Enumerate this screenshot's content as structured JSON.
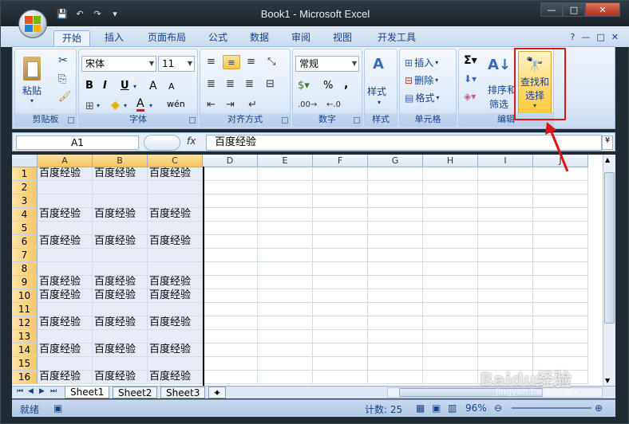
{
  "window": {
    "title": "Book1 - Microsoft Excel",
    "minimize": "—",
    "restore": "□",
    "close": "✕"
  },
  "qat": {
    "save": "💾",
    "undo": "↶",
    "redo": "↷",
    "custom": "▾"
  },
  "tabs": [
    "开始",
    "插入",
    "页面布局",
    "公式",
    "数据",
    "审阅",
    "视图",
    "开发工具"
  ],
  "tab_active": "开始",
  "ribbon": {
    "clipboard": {
      "label": "剪贴板",
      "paste": "粘贴"
    },
    "font": {
      "label": "字体",
      "name": "宋体",
      "size": "11",
      "bold": "B",
      "italic": "I",
      "underline": "U",
      "grow": "A",
      "shrink": "A",
      "wen": "wén"
    },
    "alignment": {
      "label": "对齐方式"
    },
    "number": {
      "label": "数字",
      "format": "常规",
      "percent": "%",
      "comma": ","
    },
    "styles": {
      "label": "样式",
      "button": "样式"
    },
    "cells": {
      "label": "单元格",
      "insert": "插入",
      "delete": "删除",
      "format": "格式"
    },
    "editing": {
      "label": "编辑",
      "sort": "排序和",
      "sort2": "筛选",
      "find": "查找和",
      "find2": "选择"
    }
  },
  "formula_bar": {
    "name_box": "A1",
    "fx": "fx",
    "value": "百度经验"
  },
  "columns": [
    "A",
    "B",
    "C",
    "D",
    "E",
    "F",
    "G",
    "H",
    "I",
    "J"
  ],
  "rows": [
    {
      "n": "1",
      "cells": [
        "百度经验",
        "百度经验",
        "百度经验"
      ]
    },
    {
      "n": "2",
      "cells": [
        "",
        "",
        ""
      ]
    },
    {
      "n": "3",
      "cells": [
        "",
        "",
        ""
      ]
    },
    {
      "n": "4",
      "cells": [
        "百度经验",
        "百度经验",
        "百度经验"
      ]
    },
    {
      "n": "5",
      "cells": [
        "",
        "",
        ""
      ]
    },
    {
      "n": "6",
      "cells": [
        "百度经验",
        "百度经验",
        "百度经验"
      ]
    },
    {
      "n": "7",
      "cells": [
        "",
        "",
        ""
      ]
    },
    {
      "n": "8",
      "cells": [
        "",
        "",
        ""
      ]
    },
    {
      "n": "9",
      "cells": [
        "百度经验",
        "百度经验",
        "百度经验"
      ]
    },
    {
      "n": "10",
      "cells": [
        "百度经验",
        "百度经验",
        "百度经验"
      ]
    },
    {
      "n": "11",
      "cells": [
        "",
        "",
        ""
      ]
    },
    {
      "n": "12",
      "cells": [
        "百度经验",
        "百度经验",
        "百度经验"
      ]
    },
    {
      "n": "13",
      "cells": [
        "",
        "",
        ""
      ]
    },
    {
      "n": "14",
      "cells": [
        "百度经验",
        "百度经验",
        "百度经验"
      ]
    },
    {
      "n": "15",
      "cells": [
        "",
        "",
        ""
      ]
    },
    {
      "n": "16",
      "cells": [
        "百度经验",
        "百度经验",
        "百度经验"
      ]
    }
  ],
  "sheets": [
    "Sheet1",
    "Sheet2",
    "Sheet3"
  ],
  "status": {
    "ready": "就绪",
    "count": "计数: 25",
    "zoom": "96%"
  },
  "watermark": {
    "text": "Baidu经验",
    "sub": "jingyan.baidu.com"
  },
  "colors": {
    "highlight": "#e01414",
    "ribbon_text": "#15428b"
  }
}
